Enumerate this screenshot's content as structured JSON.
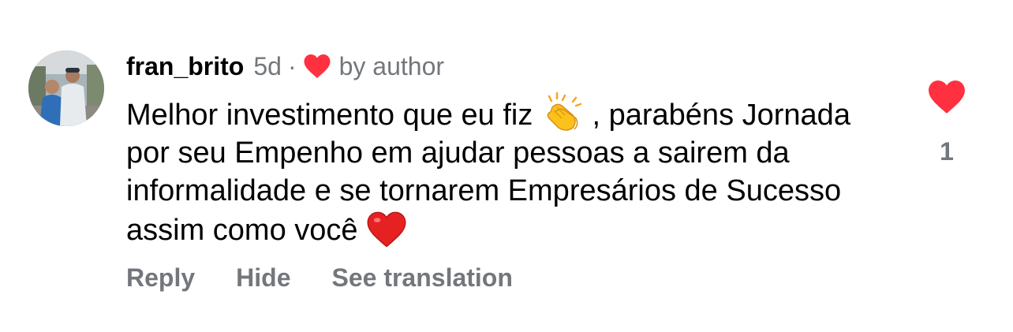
{
  "comment": {
    "username": "fran_brito",
    "time": "5d",
    "separator": "·",
    "author_like_label": "by author",
    "text_part1": "Melhor investimento que eu fiz ",
    "text_part2": " , parabéns Jornada por seu Empenho em ajudar pessoas a sairem da informalidade e se tornarem Empresários de Sucesso assim como você ",
    "emojis": [
      "clapping-hands-emoji",
      "red-heart-emoji"
    ]
  },
  "actions": {
    "reply": "Reply",
    "hide": "Hide",
    "see_translation": "See translation"
  },
  "like": {
    "count": "1",
    "icon": "heart-icon",
    "liked": true
  },
  "colors": {
    "heart": "#ff3040",
    "secondary_text": "#73777c",
    "primary_text": "#000000",
    "background": "#ffffff"
  }
}
